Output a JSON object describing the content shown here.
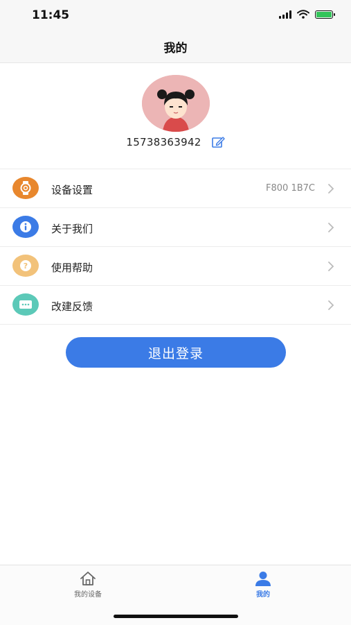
{
  "status_bar": {
    "time": "11:45"
  },
  "nav": {
    "title": "我的"
  },
  "profile": {
    "phone": "15738363942"
  },
  "menu": [
    {
      "label": "设备设置",
      "value": "F800 1B7C",
      "icon": "watch-icon",
      "color": "#e8872d"
    },
    {
      "label": "关于我们",
      "value": "",
      "icon": "info-icon",
      "color": "#3b7be6"
    },
    {
      "label": "使用帮助",
      "value": "",
      "icon": "help-icon",
      "color": "#f2c27a"
    },
    {
      "label": "改建反馈",
      "value": "",
      "icon": "chat-icon",
      "color": "#5cc9b8"
    }
  ],
  "logout": {
    "label": "退出登录"
  },
  "tab_bar": {
    "devices_label": "我的设备",
    "mine_label": "我的"
  },
  "colors": {
    "accent": "#3b7be6",
    "battery": "#33c45a"
  }
}
